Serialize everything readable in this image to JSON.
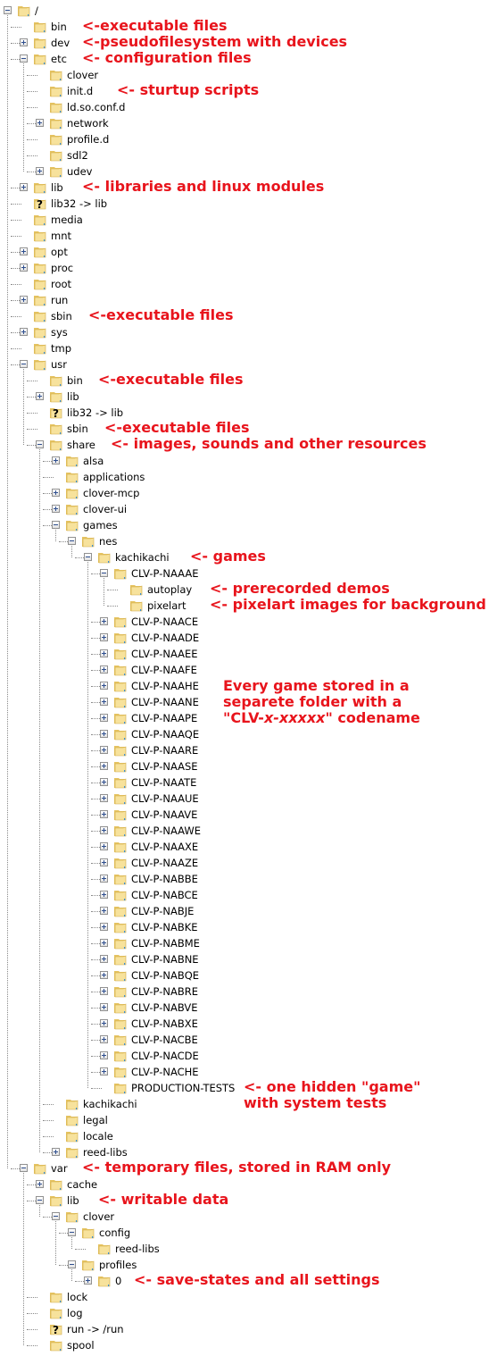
{
  "tree": [
    {
      "d": 0,
      "label": "/",
      "state": "open",
      "type": "folder"
    },
    {
      "d": 1,
      "label": "bin",
      "state": "leaf",
      "type": "folder",
      "note": "<-executable files"
    },
    {
      "d": 1,
      "label": "dev",
      "state": "closed",
      "type": "folder",
      "note": "<-pseudofilesystem with devices"
    },
    {
      "d": 1,
      "label": "etc",
      "state": "open",
      "type": "folder",
      "note": "<- configuration files"
    },
    {
      "d": 2,
      "label": "clover",
      "state": "leaf",
      "type": "folder"
    },
    {
      "d": 2,
      "label": "init.d",
      "state": "leaf",
      "type": "folder",
      "note": "<- sturtup scripts"
    },
    {
      "d": 2,
      "label": "ld.so.conf.d",
      "state": "leaf",
      "type": "folder"
    },
    {
      "d": 2,
      "label": "network",
      "state": "closed",
      "type": "folder"
    },
    {
      "d": 2,
      "label": "profile.d",
      "state": "leaf",
      "type": "folder"
    },
    {
      "d": 2,
      "label": "sdl2",
      "state": "leaf",
      "type": "folder"
    },
    {
      "d": 2,
      "label": "udev",
      "state": "closed",
      "type": "folder"
    },
    {
      "d": 1,
      "label": "lib",
      "state": "closed",
      "type": "folder",
      "note": "<- libraries and linux modules"
    },
    {
      "d": 1,
      "label": "lib32 -> lib",
      "state": "leaf",
      "type": "link"
    },
    {
      "d": 1,
      "label": "media",
      "state": "leaf",
      "type": "folder"
    },
    {
      "d": 1,
      "label": "mnt",
      "state": "leaf",
      "type": "folder"
    },
    {
      "d": 1,
      "label": "opt",
      "state": "closed",
      "type": "folder"
    },
    {
      "d": 1,
      "label": "proc",
      "state": "closed",
      "type": "folder"
    },
    {
      "d": 1,
      "label": "root",
      "state": "leaf",
      "type": "folder"
    },
    {
      "d": 1,
      "label": "run",
      "state": "closed",
      "type": "folder"
    },
    {
      "d": 1,
      "label": "sbin",
      "state": "leaf",
      "type": "folder",
      "note": "<-executable files"
    },
    {
      "d": 1,
      "label": "sys",
      "state": "closed",
      "type": "folder"
    },
    {
      "d": 1,
      "label": "tmp",
      "state": "leaf",
      "type": "folder"
    },
    {
      "d": 1,
      "label": "usr",
      "state": "open",
      "type": "folder"
    },
    {
      "d": 2,
      "label": "bin",
      "state": "leaf",
      "type": "folder",
      "note": "<-executable files"
    },
    {
      "d": 2,
      "label": "lib",
      "state": "closed",
      "type": "folder"
    },
    {
      "d": 2,
      "label": "lib32 -> lib",
      "state": "leaf",
      "type": "link"
    },
    {
      "d": 2,
      "label": "sbin",
      "state": "leaf",
      "type": "folder",
      "note": "<-executable files"
    },
    {
      "d": 2,
      "label": "share",
      "state": "open",
      "type": "folder",
      "note": "<- images, sounds and other resources"
    },
    {
      "d": 3,
      "label": "alsa",
      "state": "closed",
      "type": "folder"
    },
    {
      "d": 3,
      "label": "applications",
      "state": "leaf",
      "type": "folder"
    },
    {
      "d": 3,
      "label": "clover-mcp",
      "state": "closed",
      "type": "folder"
    },
    {
      "d": 3,
      "label": "clover-ui",
      "state": "closed",
      "type": "folder"
    },
    {
      "d": 3,
      "label": "games",
      "state": "open",
      "type": "folder"
    },
    {
      "d": 4,
      "label": "nes",
      "state": "open",
      "type": "folder"
    },
    {
      "d": 5,
      "label": "kachikachi",
      "state": "open",
      "type": "folder",
      "note": "<- games"
    },
    {
      "d": 6,
      "label": "CLV-P-NAAAE",
      "state": "open",
      "type": "folder"
    },
    {
      "d": 7,
      "label": "autoplay",
      "state": "leaf",
      "type": "folder",
      "note": "<- prerecorded demos"
    },
    {
      "d": 7,
      "label": "pixelart",
      "state": "leaf",
      "type": "folder",
      "note": "<- pixelart images for background"
    },
    {
      "d": 6,
      "label": "CLV-P-NAACE",
      "state": "closed",
      "type": "folder"
    },
    {
      "d": 6,
      "label": "CLV-P-NAADE",
      "state": "closed",
      "type": "folder"
    },
    {
      "d": 6,
      "label": "CLV-P-NAAEE",
      "state": "closed",
      "type": "folder"
    },
    {
      "d": 6,
      "label": "CLV-P-NAAFE",
      "state": "closed",
      "type": "folder"
    },
    {
      "d": 6,
      "label": "CLV-P-NAAHE",
      "state": "closed",
      "type": "folder"
    },
    {
      "d": 6,
      "label": "CLV-P-NAANE",
      "state": "closed",
      "type": "folder"
    },
    {
      "d": 6,
      "label": "CLV-P-NAAPE",
      "state": "closed",
      "type": "folder"
    },
    {
      "d": 6,
      "label": "CLV-P-NAAQE",
      "state": "closed",
      "type": "folder"
    },
    {
      "d": 6,
      "label": "CLV-P-NAARE",
      "state": "closed",
      "type": "folder"
    },
    {
      "d": 6,
      "label": "CLV-P-NAASE",
      "state": "closed",
      "type": "folder"
    },
    {
      "d": 6,
      "label": "CLV-P-NAATE",
      "state": "closed",
      "type": "folder"
    },
    {
      "d": 6,
      "label": "CLV-P-NAAUE",
      "state": "closed",
      "type": "folder"
    },
    {
      "d": 6,
      "label": "CLV-P-NAAVE",
      "state": "closed",
      "type": "folder"
    },
    {
      "d": 6,
      "label": "CLV-P-NAAWE",
      "state": "closed",
      "type": "folder"
    },
    {
      "d": 6,
      "label": "CLV-P-NAAXE",
      "state": "closed",
      "type": "folder"
    },
    {
      "d": 6,
      "label": "CLV-P-NAAZE",
      "state": "closed",
      "type": "folder"
    },
    {
      "d": 6,
      "label": "CLV-P-NABBE",
      "state": "closed",
      "type": "folder"
    },
    {
      "d": 6,
      "label": "CLV-P-NABCE",
      "state": "closed",
      "type": "folder"
    },
    {
      "d": 6,
      "label": "CLV-P-NABJE",
      "state": "closed",
      "type": "folder"
    },
    {
      "d": 6,
      "label": "CLV-P-NABKE",
      "state": "closed",
      "type": "folder"
    },
    {
      "d": 6,
      "label": "CLV-P-NABME",
      "state": "closed",
      "type": "folder"
    },
    {
      "d": 6,
      "label": "CLV-P-NABNE",
      "state": "closed",
      "type": "folder"
    },
    {
      "d": 6,
      "label": "CLV-P-NABQE",
      "state": "closed",
      "type": "folder"
    },
    {
      "d": 6,
      "label": "CLV-P-NABRE",
      "state": "closed",
      "type": "folder"
    },
    {
      "d": 6,
      "label": "CLV-P-NABVE",
      "state": "closed",
      "type": "folder"
    },
    {
      "d": 6,
      "label": "CLV-P-NABXE",
      "state": "closed",
      "type": "folder"
    },
    {
      "d": 6,
      "label": "CLV-P-NACBE",
      "state": "closed",
      "type": "folder"
    },
    {
      "d": 6,
      "label": "CLV-P-NACDE",
      "state": "closed",
      "type": "folder"
    },
    {
      "d": 6,
      "label": "CLV-P-NACHE",
      "state": "closed",
      "type": "folder"
    },
    {
      "d": 6,
      "label": "PRODUCTION-TESTS",
      "state": "leaf",
      "type": "folder",
      "note": "<- one hidden \"game\"\nwith system tests"
    },
    {
      "d": 3,
      "label": "kachikachi",
      "state": "leaf",
      "type": "folder"
    },
    {
      "d": 3,
      "label": "legal",
      "state": "leaf",
      "type": "folder"
    },
    {
      "d": 3,
      "label": "locale",
      "state": "leaf",
      "type": "folder"
    },
    {
      "d": 3,
      "label": "reed-libs",
      "state": "closed",
      "type": "folder"
    },
    {
      "d": 1,
      "label": "var",
      "state": "open",
      "type": "folder",
      "note": "<- temporary files, stored in RAM only"
    },
    {
      "d": 2,
      "label": "cache",
      "state": "closed",
      "type": "folder"
    },
    {
      "d": 2,
      "label": "lib",
      "state": "open",
      "type": "folder",
      "note": "<- writable data"
    },
    {
      "d": 3,
      "label": "clover",
      "state": "open",
      "type": "folder"
    },
    {
      "d": 4,
      "label": "config",
      "state": "open",
      "type": "folder"
    },
    {
      "d": 5,
      "label": "reed-libs",
      "state": "leaf",
      "type": "folder"
    },
    {
      "d": 4,
      "label": "profiles",
      "state": "open",
      "type": "folder"
    },
    {
      "d": 5,
      "label": "0",
      "state": "closed",
      "type": "folder",
      "note": "<- save-states and all settings"
    },
    {
      "d": 2,
      "label": "lock",
      "state": "leaf",
      "type": "folder"
    },
    {
      "d": 2,
      "label": "log",
      "state": "leaf",
      "type": "folder"
    },
    {
      "d": 2,
      "label": "run -> /run",
      "state": "leaf",
      "type": "link"
    },
    {
      "d": 2,
      "label": "spool",
      "state": "leaf",
      "type": "folder"
    }
  ],
  "games_note": {
    "line1": "Every game stored in a",
    "line2": "separete folder with a",
    "line3_pre": "\"CLV-",
    "line3_italic": "x-xxxxx",
    "line3_post": "\" codename"
  },
  "colors": {
    "note": "#e8141c",
    "folder_light": "#f8e39a",
    "folder_dark": "#d9b24a"
  }
}
